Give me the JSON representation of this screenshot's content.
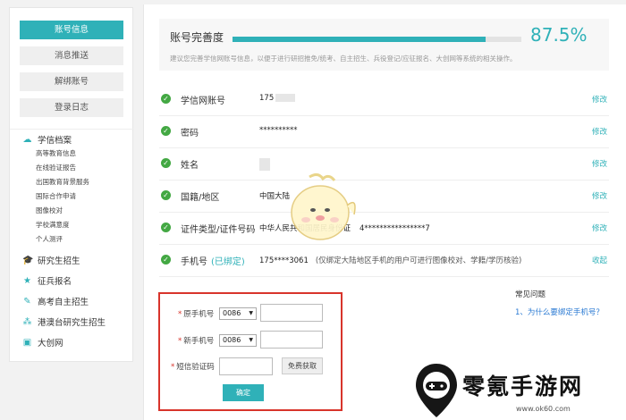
{
  "sidebar": {
    "buttons": [
      {
        "label": "账号信息",
        "active": true
      },
      {
        "label": "消息推送",
        "active": false
      },
      {
        "label": "解绑账号",
        "active": false
      },
      {
        "label": "登录日志",
        "active": false
      }
    ],
    "xuexin": {
      "label": "学信档案",
      "icon": "cloud-icon",
      "items": [
        "高等教育信息",
        "在线验证报告",
        "出国教育背景服务",
        "国际合作申请",
        "图像校对",
        "学校满意度",
        "个人测评"
      ]
    },
    "sections": [
      {
        "label": "研究生招生",
        "icon": "graduation-cap-icon"
      },
      {
        "label": "征兵报名",
        "icon": "star-icon"
      },
      {
        "label": "高考自主招生",
        "icon": "pencil-icon"
      },
      {
        "label": "港澳台研究生招生",
        "icon": "cluster-icon"
      },
      {
        "label": "大创网",
        "icon": "board-icon"
      }
    ]
  },
  "completeness": {
    "title": "账号完善度",
    "percent_text": "87.5%",
    "progress": 0.875,
    "hint": "建议您完善学信网账号信息，以便于进行研招推免/统考、自主招生、兵役登记/应征报名、大创网等系统的相关操作。"
  },
  "rows": [
    {
      "label": "学信网账号",
      "value": "175",
      "action": "修改"
    },
    {
      "label": "密码",
      "value": "**********",
      "action": "修改"
    },
    {
      "label": "姓名",
      "value": "",
      "action": "修改"
    },
    {
      "label": "国籍/地区",
      "value": "中国大陆",
      "action": "修改"
    },
    {
      "label": "证件类型/证件号码",
      "value": "中华人民共和国居民身份证",
      "value2": "4****************7",
      "action": "修改"
    },
    {
      "label": "手机号",
      "bound": "(已绑定)",
      "value": "175****3061",
      "note": "(仅绑定大陆地区手机的用户可进行图像校对、学籍/学历核验)",
      "action": "收起"
    }
  ],
  "form": {
    "old_phone_label": "原手机号",
    "new_phone_label": "新手机号",
    "code_label": "短信验证码",
    "country_code": "0086",
    "get_code_label": "免费获取",
    "submit_label": "确定"
  },
  "faq": {
    "title": "常见问题",
    "item": "1、为什么要绑定手机号？"
  },
  "watermark": {
    "text": "零氪手游网",
    "url": "www.ok60.com"
  },
  "colors": {
    "accent": "#2fb1b8",
    "success": "#43a843",
    "highlight": "#d8342b"
  }
}
